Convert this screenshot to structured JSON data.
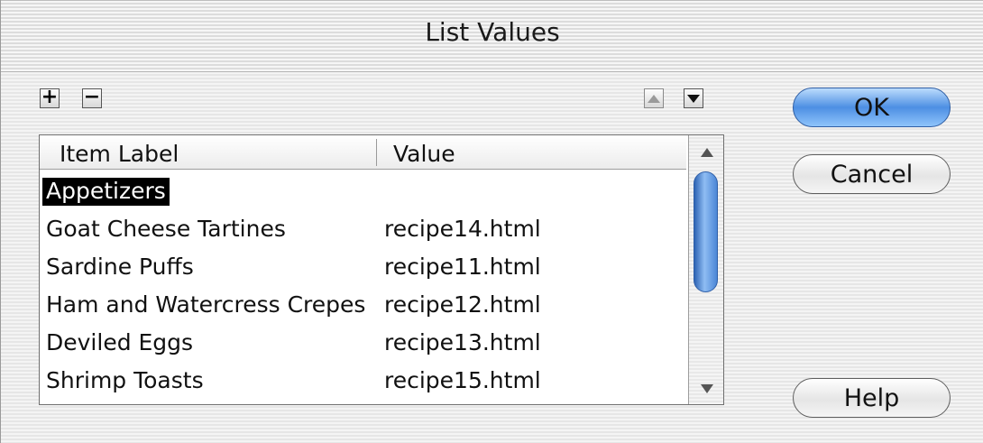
{
  "window": {
    "title": "List Values"
  },
  "toolbar": {
    "add_label": "+",
    "remove_label": "−",
    "move_up_icon": "triangle-up-icon",
    "move_down_icon": "triangle-down-icon"
  },
  "list": {
    "columns": [
      "Item Label",
      "Value"
    ],
    "rows": [
      {
        "label": "Appetizers",
        "value": "",
        "selected": true
      },
      {
        "label": "Goat Cheese Tartines",
        "value": "recipe14.html"
      },
      {
        "label": "Sardine Puffs",
        "value": "recipe11.html"
      },
      {
        "label": "Ham and Watercress Crepes",
        "value": "recipe12.html"
      },
      {
        "label": "Deviled Eggs",
        "value": "recipe13.html"
      },
      {
        "label": "Shrimp Toasts",
        "value": "recipe15.html"
      }
    ]
  },
  "buttons": {
    "ok": "OK",
    "cancel": "Cancel",
    "help": "Help"
  },
  "colors": {
    "selection": "#000000",
    "accent": "#4d8fe3"
  }
}
